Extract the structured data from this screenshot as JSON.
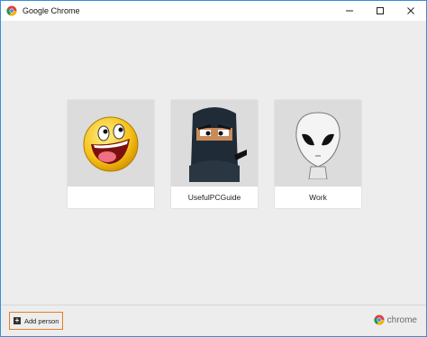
{
  "window": {
    "title": "Google Chrome",
    "controls": [
      "minimize-icon",
      "maximize-icon",
      "close-icon"
    ]
  },
  "profiles": [
    {
      "label": "",
      "avatar": "smiley-face-avatar"
    },
    {
      "label": "UsefulPCGuide",
      "avatar": "ninja-avatar"
    },
    {
      "label": "Work",
      "avatar": "alien-avatar"
    }
  ],
  "footer": {
    "add_person_label": "Add person",
    "brand_text": "chrome"
  },
  "colors": {
    "window_border": "#3a8fd6",
    "highlight_border": "#e47f21",
    "background": "#ededed",
    "avatar_bg": "#dcdcdc"
  }
}
